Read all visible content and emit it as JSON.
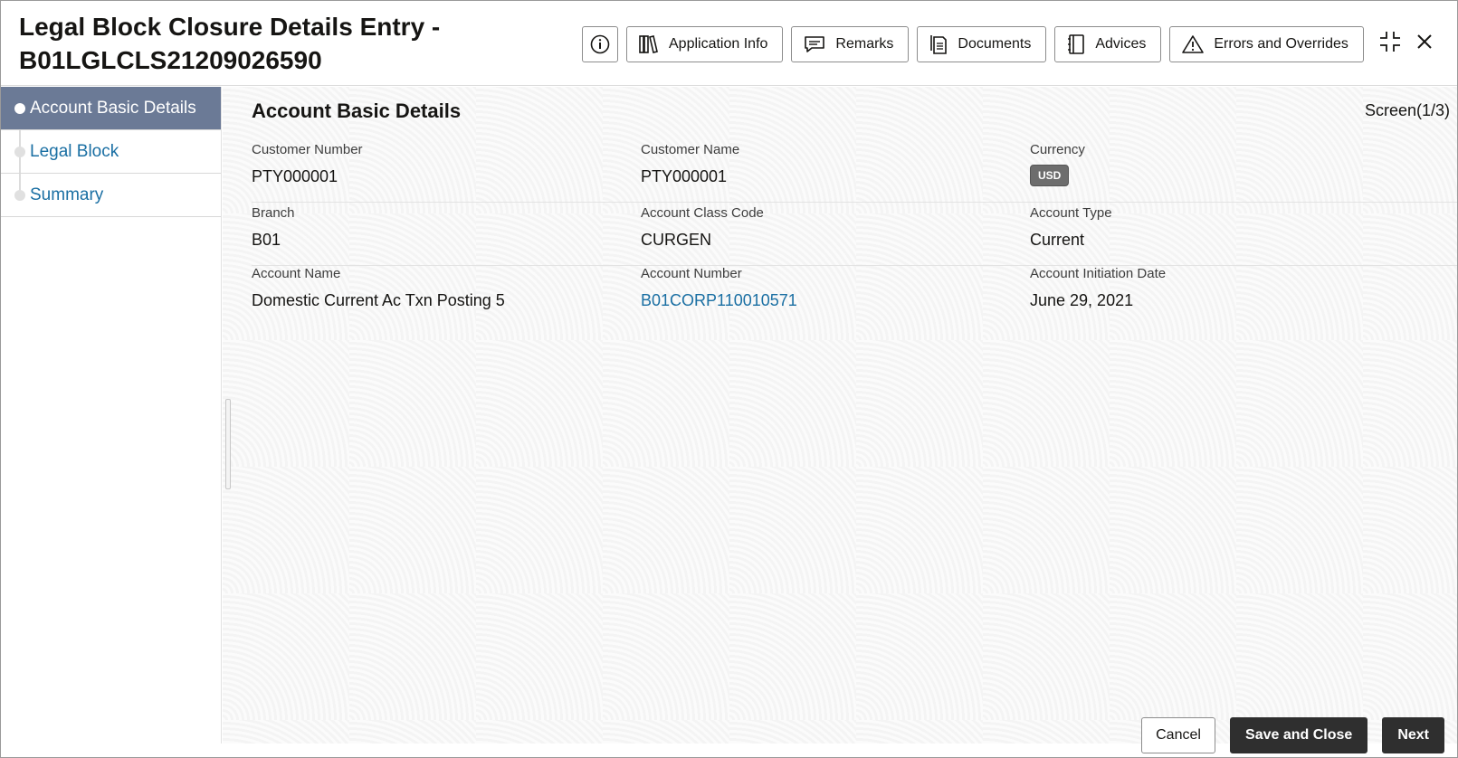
{
  "header": {
    "title": "Legal Block Closure Details Entry - B01LGLCLS21209026590",
    "toolbar": [
      {
        "label": "",
        "icon": "info-icon"
      },
      {
        "label": "Application Info",
        "icon": "books-icon"
      },
      {
        "label": "Remarks",
        "icon": "chat-icon"
      },
      {
        "label": "Documents",
        "icon": "documents-icon"
      },
      {
        "label": "Advices",
        "icon": "notebook-icon"
      },
      {
        "label": "Errors and Overrides",
        "icon": "warning-icon"
      }
    ],
    "window_icons": [
      "minimize-icon",
      "close-icon"
    ]
  },
  "sidebar": {
    "steps": [
      {
        "label": "Account Basic Details",
        "active": true
      },
      {
        "label": "Legal Block",
        "active": false
      },
      {
        "label": "Summary",
        "active": false
      }
    ]
  },
  "main": {
    "section_title": "Account Basic Details",
    "screen_count": "Screen(1/3)",
    "rows": [
      [
        {
          "label": "Customer Number",
          "value": "PTY000001"
        },
        {
          "label": "Customer Name",
          "value": "PTY000001"
        },
        {
          "label": "Currency",
          "value": "USD"
        }
      ],
      [
        {
          "label": "Branch",
          "value": "B01"
        },
        {
          "label": "Account Class Code",
          "value": "CURGEN"
        },
        {
          "label": "Account Type",
          "value": "Current"
        }
      ],
      [
        {
          "label": "Account Name",
          "value": "Domestic Current Ac Txn Posting 5"
        },
        {
          "label": "Account Number",
          "value": "B01CORP110010571"
        },
        {
          "label": "Account Initiation Date",
          "value": "June 29, 2021"
        }
      ]
    ]
  },
  "footer": {
    "cancel_label": "Cancel",
    "save_close_label": "Save and Close",
    "next_label": "Next"
  },
  "colors": {
    "active_step_bg": "#6b7a96",
    "link": "#1a6fa3",
    "primary_button": "#2f2f2f",
    "badge": "#6d6d6d"
  }
}
